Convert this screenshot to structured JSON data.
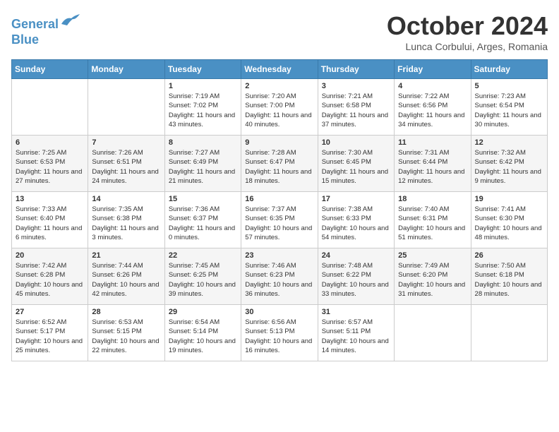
{
  "header": {
    "logo_line1": "General",
    "logo_line2": "Blue",
    "month": "October 2024",
    "location": "Lunca Corbului, Arges, Romania"
  },
  "weekdays": [
    "Sunday",
    "Monday",
    "Tuesday",
    "Wednesday",
    "Thursday",
    "Friday",
    "Saturday"
  ],
  "weeks": [
    [
      {
        "day": "",
        "info": ""
      },
      {
        "day": "",
        "info": ""
      },
      {
        "day": "1",
        "info": "Sunrise: 7:19 AM\nSunset: 7:02 PM\nDaylight: 11 hours and 43 minutes."
      },
      {
        "day": "2",
        "info": "Sunrise: 7:20 AM\nSunset: 7:00 PM\nDaylight: 11 hours and 40 minutes."
      },
      {
        "day": "3",
        "info": "Sunrise: 7:21 AM\nSunset: 6:58 PM\nDaylight: 11 hours and 37 minutes."
      },
      {
        "day": "4",
        "info": "Sunrise: 7:22 AM\nSunset: 6:56 PM\nDaylight: 11 hours and 34 minutes."
      },
      {
        "day": "5",
        "info": "Sunrise: 7:23 AM\nSunset: 6:54 PM\nDaylight: 11 hours and 30 minutes."
      }
    ],
    [
      {
        "day": "6",
        "info": "Sunrise: 7:25 AM\nSunset: 6:53 PM\nDaylight: 11 hours and 27 minutes."
      },
      {
        "day": "7",
        "info": "Sunrise: 7:26 AM\nSunset: 6:51 PM\nDaylight: 11 hours and 24 minutes."
      },
      {
        "day": "8",
        "info": "Sunrise: 7:27 AM\nSunset: 6:49 PM\nDaylight: 11 hours and 21 minutes."
      },
      {
        "day": "9",
        "info": "Sunrise: 7:28 AM\nSunset: 6:47 PM\nDaylight: 11 hours and 18 minutes."
      },
      {
        "day": "10",
        "info": "Sunrise: 7:30 AM\nSunset: 6:45 PM\nDaylight: 11 hours and 15 minutes."
      },
      {
        "day": "11",
        "info": "Sunrise: 7:31 AM\nSunset: 6:44 PM\nDaylight: 11 hours and 12 minutes."
      },
      {
        "day": "12",
        "info": "Sunrise: 7:32 AM\nSunset: 6:42 PM\nDaylight: 11 hours and 9 minutes."
      }
    ],
    [
      {
        "day": "13",
        "info": "Sunrise: 7:33 AM\nSunset: 6:40 PM\nDaylight: 11 hours and 6 minutes."
      },
      {
        "day": "14",
        "info": "Sunrise: 7:35 AM\nSunset: 6:38 PM\nDaylight: 11 hours and 3 minutes."
      },
      {
        "day": "15",
        "info": "Sunrise: 7:36 AM\nSunset: 6:37 PM\nDaylight: 11 hours and 0 minutes."
      },
      {
        "day": "16",
        "info": "Sunrise: 7:37 AM\nSunset: 6:35 PM\nDaylight: 10 hours and 57 minutes."
      },
      {
        "day": "17",
        "info": "Sunrise: 7:38 AM\nSunset: 6:33 PM\nDaylight: 10 hours and 54 minutes."
      },
      {
        "day": "18",
        "info": "Sunrise: 7:40 AM\nSunset: 6:31 PM\nDaylight: 10 hours and 51 minutes."
      },
      {
        "day": "19",
        "info": "Sunrise: 7:41 AM\nSunset: 6:30 PM\nDaylight: 10 hours and 48 minutes."
      }
    ],
    [
      {
        "day": "20",
        "info": "Sunrise: 7:42 AM\nSunset: 6:28 PM\nDaylight: 10 hours and 45 minutes."
      },
      {
        "day": "21",
        "info": "Sunrise: 7:44 AM\nSunset: 6:26 PM\nDaylight: 10 hours and 42 minutes."
      },
      {
        "day": "22",
        "info": "Sunrise: 7:45 AM\nSunset: 6:25 PM\nDaylight: 10 hours and 39 minutes."
      },
      {
        "day": "23",
        "info": "Sunrise: 7:46 AM\nSunset: 6:23 PM\nDaylight: 10 hours and 36 minutes."
      },
      {
        "day": "24",
        "info": "Sunrise: 7:48 AM\nSunset: 6:22 PM\nDaylight: 10 hours and 33 minutes."
      },
      {
        "day": "25",
        "info": "Sunrise: 7:49 AM\nSunset: 6:20 PM\nDaylight: 10 hours and 31 minutes."
      },
      {
        "day": "26",
        "info": "Sunrise: 7:50 AM\nSunset: 6:18 PM\nDaylight: 10 hours and 28 minutes."
      }
    ],
    [
      {
        "day": "27",
        "info": "Sunrise: 6:52 AM\nSunset: 5:17 PM\nDaylight: 10 hours and 25 minutes."
      },
      {
        "day": "28",
        "info": "Sunrise: 6:53 AM\nSunset: 5:15 PM\nDaylight: 10 hours and 22 minutes."
      },
      {
        "day": "29",
        "info": "Sunrise: 6:54 AM\nSunset: 5:14 PM\nDaylight: 10 hours and 19 minutes."
      },
      {
        "day": "30",
        "info": "Sunrise: 6:56 AM\nSunset: 5:13 PM\nDaylight: 10 hours and 16 minutes."
      },
      {
        "day": "31",
        "info": "Sunrise: 6:57 AM\nSunset: 5:11 PM\nDaylight: 10 hours and 14 minutes."
      },
      {
        "day": "",
        "info": ""
      },
      {
        "day": "",
        "info": ""
      }
    ]
  ]
}
